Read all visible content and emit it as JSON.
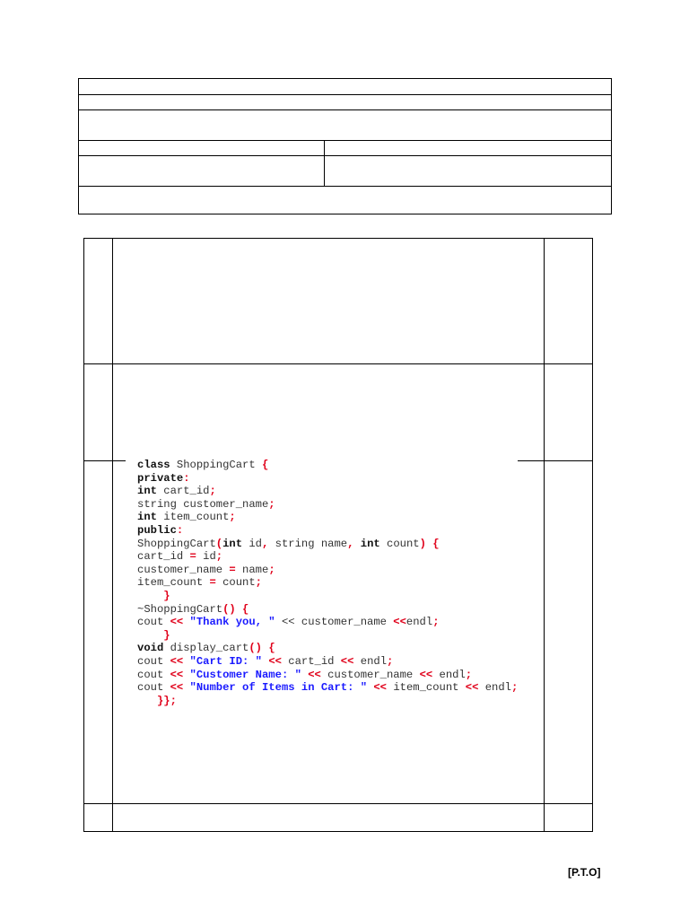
{
  "code": {
    "lines": [
      [
        [
          "class",
          "k"
        ],
        [
          " ShoppingCart ",
          ""
        ],
        [
          "{",
          "p"
        ]
      ],
      [
        [
          "private",
          "k"
        ],
        [
          ":",
          "p"
        ]
      ],
      [
        [
          "int",
          "k"
        ],
        [
          " cart_id",
          ""
        ],
        [
          ";",
          "p"
        ]
      ],
      [
        [
          "string customer_name",
          ""
        ],
        [
          ";",
          "p"
        ]
      ],
      [
        [
          "int",
          "k"
        ],
        [
          " item_count",
          ""
        ],
        [
          ";",
          "p"
        ]
      ],
      [
        [
          "public",
          "k"
        ],
        [
          ":",
          "p"
        ]
      ],
      [
        [
          "ShoppingCart",
          ""
        ],
        [
          "(",
          "p"
        ],
        [
          "int",
          "k"
        ],
        [
          " id",
          ""
        ],
        [
          ",",
          "p"
        ],
        [
          " string name",
          ""
        ],
        [
          ",",
          "p"
        ],
        [
          " ",
          ""
        ],
        [
          "int",
          "k"
        ],
        [
          " count",
          ""
        ],
        [
          ")",
          "p"
        ],
        [
          " ",
          ""
        ],
        [
          "{",
          "p"
        ]
      ],
      [
        [
          "cart_id ",
          ""
        ],
        [
          "=",
          "p"
        ],
        [
          " id",
          ""
        ],
        [
          ";",
          "p"
        ]
      ],
      [
        [
          "customer_name ",
          ""
        ],
        [
          "=",
          "p"
        ],
        [
          " name",
          ""
        ],
        [
          ";",
          "p"
        ]
      ],
      [
        [
          "item_count ",
          ""
        ],
        [
          "=",
          "p"
        ],
        [
          " count",
          ""
        ],
        [
          ";",
          "p"
        ]
      ],
      [
        [
          "    ",
          ""
        ],
        [
          "}",
          "p"
        ]
      ],
      [
        [
          "~ShoppingCart",
          ""
        ],
        [
          "()",
          "p"
        ],
        [
          " ",
          ""
        ],
        [
          "{",
          "p"
        ]
      ],
      [
        [
          "cout ",
          ""
        ],
        [
          "<<",
          "p"
        ],
        [
          " ",
          ""
        ],
        [
          "\"Thank you, \"",
          "s"
        ],
        [
          " << customer_name ",
          ""
        ],
        [
          "<<",
          "p"
        ],
        [
          "endl",
          ""
        ],
        [
          ";",
          "p"
        ]
      ],
      [
        [
          "    ",
          ""
        ],
        [
          "}",
          "p"
        ]
      ],
      [
        [
          "void",
          "k"
        ],
        [
          " display_cart",
          ""
        ],
        [
          "()",
          "p"
        ],
        [
          " ",
          ""
        ],
        [
          "{",
          "p"
        ]
      ],
      [
        [
          "cout ",
          ""
        ],
        [
          "<<",
          "p"
        ],
        [
          " ",
          ""
        ],
        [
          "\"Cart ID: \"",
          "s"
        ],
        [
          " ",
          ""
        ],
        [
          "<<",
          "p"
        ],
        [
          " cart_id ",
          ""
        ],
        [
          "<<",
          "p"
        ],
        [
          " endl",
          ""
        ],
        [
          ";",
          "p"
        ]
      ],
      [
        [
          "cout ",
          ""
        ],
        [
          "<<",
          "p"
        ],
        [
          " ",
          ""
        ],
        [
          "\"Customer Name: \"",
          "s"
        ],
        [
          " ",
          ""
        ],
        [
          "<<",
          "p"
        ],
        [
          " customer_name ",
          ""
        ],
        [
          "<<",
          "p"
        ],
        [
          " endl",
          ""
        ],
        [
          ";",
          "p"
        ]
      ],
      [
        [
          "cout ",
          ""
        ],
        [
          "<<",
          "p"
        ],
        [
          " ",
          ""
        ],
        [
          "\"Number of Items in Cart: \"",
          "s"
        ],
        [
          " ",
          ""
        ],
        [
          "<<",
          "p"
        ],
        [
          " item_count ",
          ""
        ],
        [
          "<<",
          "p"
        ],
        [
          " endl",
          ""
        ],
        [
          ";",
          "p"
        ]
      ],
      [
        [
          "   ",
          ""
        ],
        [
          "}};",
          "p"
        ]
      ]
    ]
  },
  "footer": {
    "pto": "[P.T.O]"
  }
}
